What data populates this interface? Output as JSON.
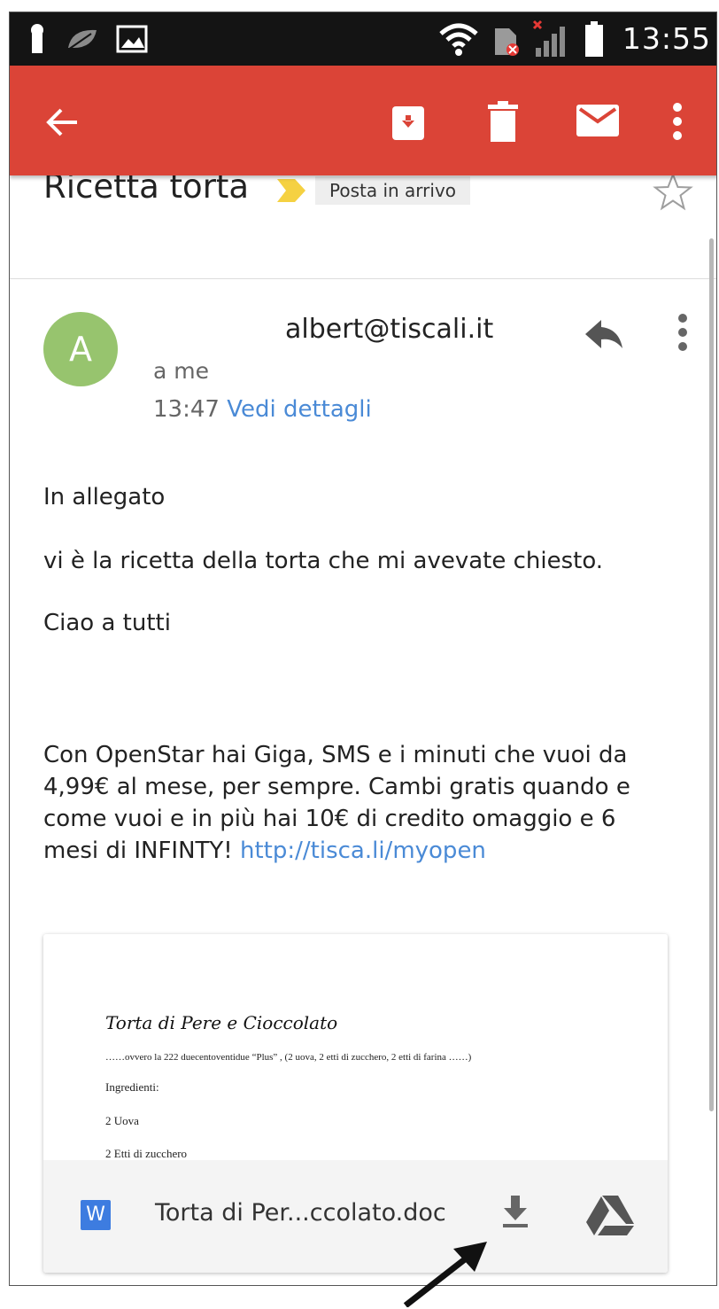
{
  "statusbar": {
    "time": "13:55",
    "icons": [
      "keyhole-icon",
      "leaf-icon",
      "image-icon",
      "wifi-icon",
      "sim-error-icon",
      "signal-icon",
      "battery-icon"
    ]
  },
  "appbar": {
    "color": "#db4437",
    "actions": [
      "back-arrow-icon",
      "archive-icon",
      "delete-icon",
      "mail-icon",
      "overflow-menu-icon"
    ]
  },
  "email": {
    "subject": "Ricetta torta",
    "label": "Posta in arrivo",
    "avatar_letter": "A",
    "avatar_color": "#97c46e",
    "sender": "albert@tiscali.it",
    "to": "a me",
    "time": "13:47",
    "details_link": "Vedi dettagli",
    "body": {
      "line1": "In allegato",
      "line2": "vi è la ricetta della torta che mi avevate chiesto.",
      "line3": "Ciao a tutti"
    },
    "promo_text": "Con OpenStar hai Giga, SMS e i minuti che vuoi da 4,99€ al mese, per sempre. Cambi gratis quando e come vuoi e in più hai 10€ di credito omaggio e 6 mesi di INFINTY! ",
    "promo_link": "http://tisca.li/myopen"
  },
  "attachment": {
    "preview_title": "Torta di  Pere e Cioccolato",
    "preview_lines": {
      "l1": "……ovvero la 222 duecentoventidue “Plus” , (2 uova, 2 etti di zucchero, 2 etti di farina ……)",
      "l2": "Ingredienti:",
      "l3": "2 Uova",
      "l4": "2 Etti di zucchero"
    },
    "type_badge": "W",
    "file_name": "Torta di Per...ccolato.doc"
  }
}
